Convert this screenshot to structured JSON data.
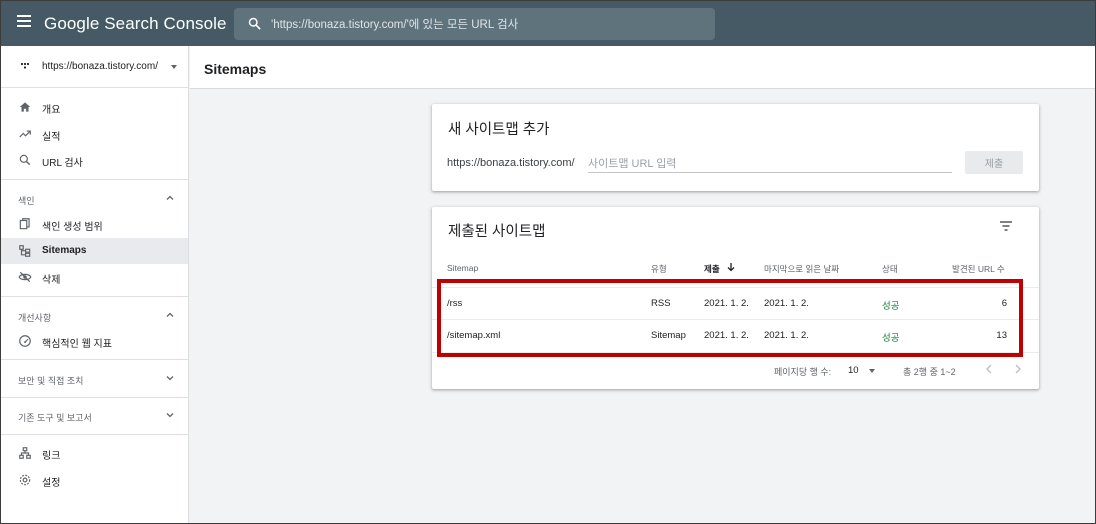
{
  "header": {
    "brand": "Google Search Console",
    "search_placeholder": "'https://bonaza.tistory.com/'에 있는 모든 URL 검사"
  },
  "sidebar": {
    "property": "https://bonaza.tistory.com/",
    "top_items": [
      {
        "label": "개요",
        "icon": "home-icon"
      },
      {
        "label": "실적",
        "icon": "trending-up-icon"
      },
      {
        "label": "URL 검사",
        "icon": "search-icon"
      }
    ],
    "sections": {
      "index": {
        "label": "색인",
        "items": [
          {
            "label": "색인 생성 범위",
            "icon": "copy-icon"
          },
          {
            "label": "Sitemaps",
            "icon": "sitemap-icon",
            "active": true
          },
          {
            "label": "삭제",
            "icon": "eye-off-icon"
          }
        ]
      },
      "enhancements": {
        "label": "개선사항",
        "items": [
          {
            "label": "핵심적인 웹 지표",
            "icon": "gauge-icon"
          }
        ]
      },
      "security": {
        "label": "보안 및 직접 조치"
      },
      "legacy": {
        "label": "기존 도구 및 보고서"
      }
    },
    "bottom_items": [
      {
        "label": "링크",
        "icon": "links-icon"
      },
      {
        "label": "설정",
        "icon": "settings-icon"
      }
    ]
  },
  "page": {
    "title": "Sitemaps"
  },
  "add_card": {
    "title": "새 사이트맵 추가",
    "prefix": "https://bonaza.tistory.com/",
    "input_placeholder": "사이트맵 URL 입력",
    "submit_label": "제출"
  },
  "submitted_card": {
    "title": "제출된 사이트맵",
    "columns": {
      "sitemap": "Sitemap",
      "type": "유형",
      "submitted": "제출",
      "last_read": "마지막으로 읽은 날짜",
      "status": "상태",
      "found_urls": "발견된 URL 수"
    },
    "rows": [
      {
        "sitemap": "/rss",
        "type": "RSS",
        "submitted": "2021. 1. 2.",
        "last_read": "2021. 1. 2.",
        "status": "성공",
        "found_urls": "6"
      },
      {
        "sitemap": "/sitemap.xml",
        "type": "Sitemap",
        "submitted": "2021. 1. 2.",
        "last_read": "2021. 1. 2.",
        "status": "성공",
        "found_urls": "13"
      }
    ],
    "pager": {
      "rows_per_page_label": "페이지당 행 수:",
      "rows_per_page": "10",
      "range": "총 2행 중 1~2"
    }
  },
  "colors": {
    "header_bg": "#455a64",
    "success": "#188038",
    "highlight": "#c00000"
  }
}
